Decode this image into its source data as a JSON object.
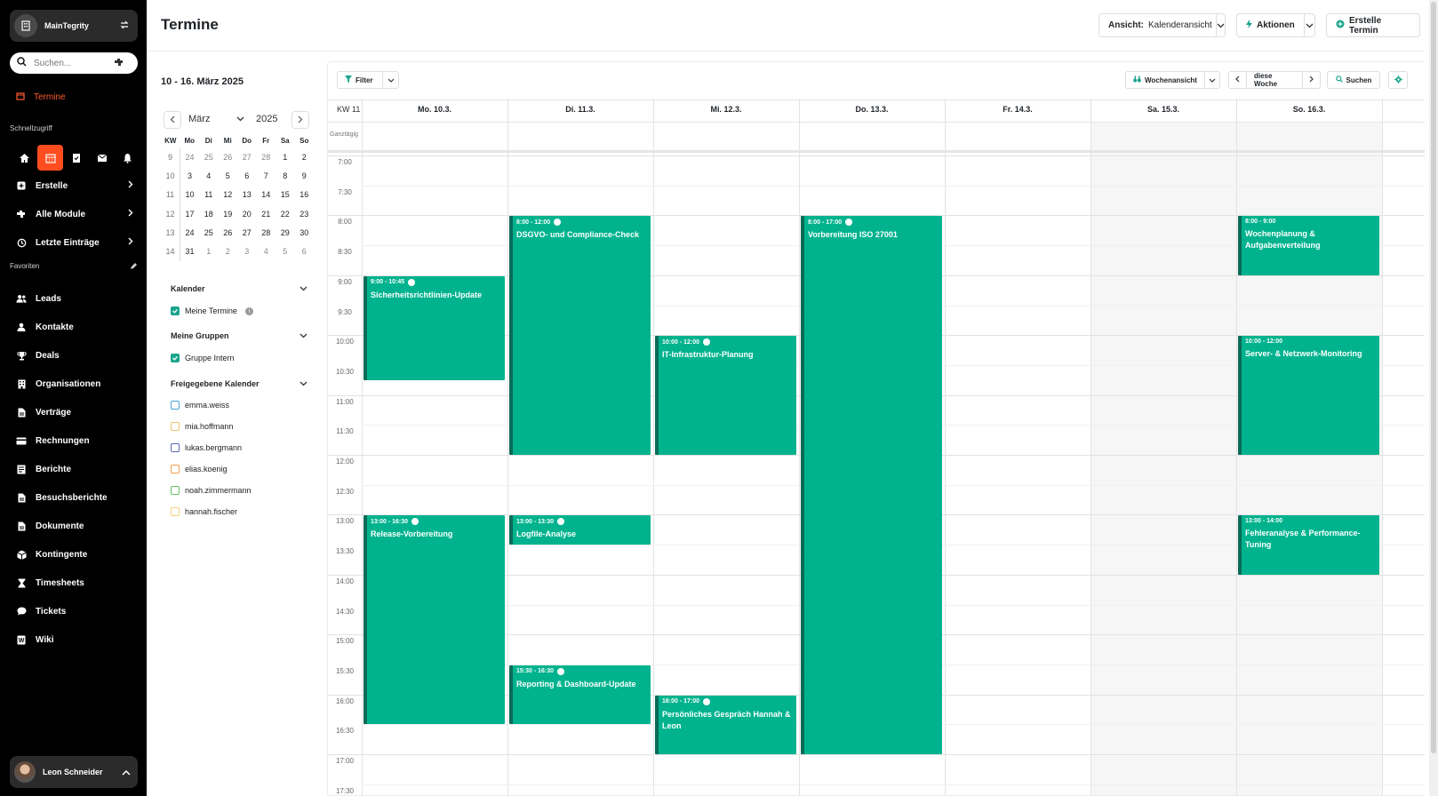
{
  "workspace": {
    "name": "MainTegrity"
  },
  "search": {
    "placeholder": "Suchen..."
  },
  "nav": {
    "active": "Termine"
  },
  "quick_access": {
    "label": "Schnellzugriff"
  },
  "menu": [
    {
      "label": "Erstelle",
      "icon": "plus-square-icon"
    },
    {
      "label": "Alle Module",
      "icon": "puzzle-icon"
    },
    {
      "label": "Letzte Einträge",
      "icon": "history-icon"
    }
  ],
  "favorites": {
    "label": "Favoriten",
    "items": [
      {
        "label": "Leads",
        "icon": "users-icon"
      },
      {
        "label": "Kontakte",
        "icon": "user-icon"
      },
      {
        "label": "Deals",
        "icon": "trophy-icon"
      },
      {
        "label": "Organisationen",
        "icon": "building-icon"
      },
      {
        "label": "Verträge",
        "icon": "document-icon"
      },
      {
        "label": "Rechnungen",
        "icon": "credit-card-icon"
      },
      {
        "label": "Berichte",
        "icon": "report-icon"
      },
      {
        "label": "Besuchsberichte",
        "icon": "document-icon"
      },
      {
        "label": "Dokumente",
        "icon": "document-icon"
      },
      {
        "label": "Kontingente",
        "icon": "box-icon"
      },
      {
        "label": "Timesheets",
        "icon": "hourglass-icon"
      },
      {
        "label": "Tickets",
        "icon": "chat-icon"
      },
      {
        "label": "Wiki",
        "icon": "wiki-icon"
      }
    ]
  },
  "user": {
    "name": "Leon Schneider"
  },
  "page": {
    "title": "Termine"
  },
  "header": {
    "view_prefix": "Ansicht:",
    "view_value": "Kalenderansicht",
    "actions": "Aktionen",
    "create": "Erstelle Termin"
  },
  "mini_cal": {
    "range": "10 - 16. März 2025",
    "month": "März",
    "year": "2025",
    "headers": [
      "KW",
      "Mo",
      "Di",
      "Mi",
      "Do",
      "Fr",
      "Sa",
      "So"
    ],
    "weeks": [
      {
        "kw": "9",
        "days": [
          "24",
          "25",
          "26",
          "27",
          "28",
          "1",
          "2"
        ]
      },
      {
        "kw": "10",
        "days": [
          "3",
          "4",
          "5",
          "6",
          "7",
          "8",
          "9"
        ]
      },
      {
        "kw": "11",
        "days": [
          "10",
          "11",
          "12",
          "13",
          "14",
          "15",
          "16"
        ]
      },
      {
        "kw": "12",
        "days": [
          "17",
          "18",
          "19",
          "20",
          "21",
          "22",
          "23"
        ]
      },
      {
        "kw": "13",
        "days": [
          "24",
          "25",
          "26",
          "27",
          "28",
          "29",
          "30"
        ]
      },
      {
        "kw": "14",
        "days": [
          "31",
          "1",
          "2",
          "3",
          "4",
          "5",
          "6"
        ]
      }
    ]
  },
  "filters": {
    "calendar": {
      "label": "Kalender",
      "item": "Meine Termine"
    },
    "groups": {
      "label": "Meine Gruppen",
      "item": "Gruppe Intern"
    },
    "shared": {
      "label": "Freigegebene Kalender",
      "items": [
        {
          "label": "emma.weiss",
          "color": "#4aa3d8"
        },
        {
          "label": "mia.hoffmann",
          "color": "#e9c46a"
        },
        {
          "label": "lukas.bergmann",
          "color": "#5b6bb5"
        },
        {
          "label": "elias.koenig",
          "color": "#f0a04b"
        },
        {
          "label": "noah.zimmermann",
          "color": "#6abf69"
        },
        {
          "label": "hannah.fischer",
          "color": "#f2d27a"
        }
      ]
    }
  },
  "toolbar": {
    "filter": "Filter",
    "view": "Wochenansicht",
    "this_week": "diese Woche",
    "search": "Suchen"
  },
  "week": {
    "kw": "KW 11",
    "days": [
      "Mo. 10.3.",
      "Di. 11.3.",
      "Mi. 12.3.",
      "Do. 13.3.",
      "Fr. 14.3.",
      "Sa. 15.3.",
      "So. 16.3."
    ],
    "allday_label": "Ganztägig",
    "hours": [
      "7:00",
      "7:30",
      "8:00",
      "8:30",
      "9:00",
      "9:30",
      "10:00",
      "10:30",
      "11:00",
      "11:30",
      "12:00",
      "12:30",
      "13:00",
      "13:30",
      "14:00",
      "14:30",
      "15:00",
      "15:30",
      "16:00",
      "16:30",
      "17:00",
      "17:30"
    ],
    "event_color": "#00b38e"
  },
  "events": [
    {
      "day": 0,
      "start": 9,
      "end": 10.75,
      "time": "9:00 - 10:45",
      "title": "Sicherheitsrichtlinien-Update",
      "check": true
    },
    {
      "day": 0,
      "start": 13,
      "end": 16.5,
      "time": "13:00 - 16:30",
      "title": "Release-Vorbereitung",
      "check": true
    },
    {
      "day": 1,
      "start": 8,
      "end": 12,
      "time": "8:00 - 12:00",
      "title": "DSGVO- und Compliance-Check",
      "check": true
    },
    {
      "day": 1,
      "start": 13,
      "end": 13.5,
      "time": "13:00 - 13:30",
      "title": "Logfile-Analyse",
      "check": true
    },
    {
      "day": 1,
      "start": 15.5,
      "end": 16.5,
      "time": "15:30 - 16:30",
      "title": "Reporting & Dashboard-Update",
      "check": true
    },
    {
      "day": 2,
      "start": 10,
      "end": 12,
      "time": "10:00 - 12:00",
      "title": "IT-Infrastruktur-Planung",
      "check": true
    },
    {
      "day": 2,
      "start": 16,
      "end": 17,
      "time": "16:00 - 17:00",
      "title": "Persönliches Gespräch Hannah & Leon",
      "check": true
    },
    {
      "day": 3,
      "start": 8,
      "end": 17,
      "time": "8:00 - 17:00",
      "title": "Vorbereitung ISO 27001",
      "check": true
    },
    {
      "day": 6,
      "start": 8,
      "end": 9,
      "time": "8:00 - 9:00",
      "title": "Wochenplanung & Aufgabenverteilung",
      "check": false
    },
    {
      "day": 6,
      "start": 10,
      "end": 12,
      "time": "10:00 - 12:00",
      "title": "Server- & Netzwerk-Monitoring",
      "check": false
    },
    {
      "day": 6,
      "start": 13,
      "end": 14,
      "time": "13:00 - 14:00",
      "title": "Fehleranalyse & Performance-Tuning",
      "check": false
    }
  ]
}
